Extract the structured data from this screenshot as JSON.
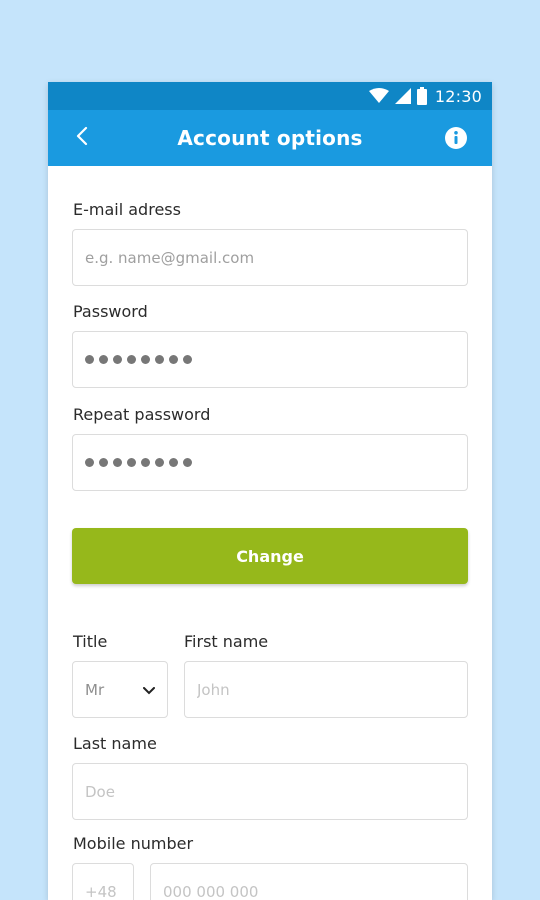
{
  "status_bar": {
    "time": "12:30",
    "icons": [
      "wifi-icon",
      "signal-icon",
      "battery-icon"
    ]
  },
  "app_bar": {
    "title": "Account options",
    "back_icon": "chevron-left-icon",
    "info_icon": "info-icon"
  },
  "account": {
    "email_label": "E-mail adress",
    "email_placeholder": "e.g. name@gmail.com",
    "password_label": "Password",
    "password_mask_count": 8,
    "repeat_password_label": "Repeat password",
    "repeat_password_mask_count": 8,
    "change_button": "Change"
  },
  "personal": {
    "title_label": "Title",
    "title_value": "Mr",
    "first_name_label": "First name",
    "first_name_placeholder": "John",
    "last_name_label": "Last name",
    "last_name_placeholder": "Doe",
    "mobile_label": "Mobile number",
    "country_code_placeholder": "+48",
    "phone_placeholder": "000 000 000"
  },
  "colors": {
    "page_background": "#c5e4fb",
    "status_bar": "#0f86c6",
    "app_bar": "#1a9ae0",
    "change_button": "#96b81b"
  }
}
